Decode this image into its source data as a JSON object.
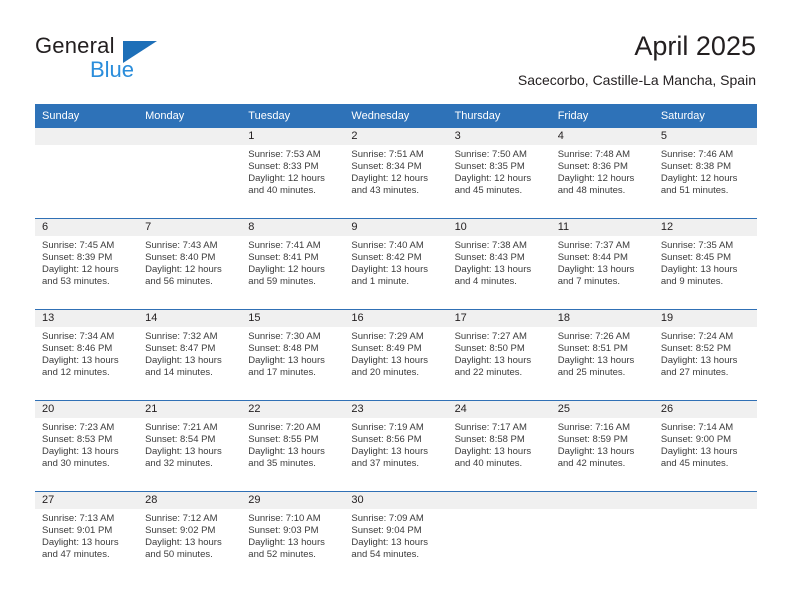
{
  "brand": {
    "name_part1": "General",
    "name_part2": "Blue",
    "flag_icon": "triangle-flag-icon",
    "color_dark": "#231f20",
    "color_blue": "#2a8ddb"
  },
  "header": {
    "title": "April 2025",
    "subtitle": "Sacecorbo, Castille-La Mancha, Spain",
    "accent_color": "#2e72b8",
    "band_color": "#f0f0f0"
  },
  "weekdays": [
    "Sunday",
    "Monday",
    "Tuesday",
    "Wednesday",
    "Thursday",
    "Friday",
    "Saturday"
  ],
  "weeks": [
    [
      {
        "day": "",
        "blank": true
      },
      {
        "day": "",
        "blank": true
      },
      {
        "day": "1",
        "sunrise": "Sunrise: 7:53 AM",
        "sunset": "Sunset: 8:33 PM",
        "daylight_1": "Daylight: 12 hours",
        "daylight_2": "and 40 minutes."
      },
      {
        "day": "2",
        "sunrise": "Sunrise: 7:51 AM",
        "sunset": "Sunset: 8:34 PM",
        "daylight_1": "Daylight: 12 hours",
        "daylight_2": "and 43 minutes."
      },
      {
        "day": "3",
        "sunrise": "Sunrise: 7:50 AM",
        "sunset": "Sunset: 8:35 PM",
        "daylight_1": "Daylight: 12 hours",
        "daylight_2": "and 45 minutes."
      },
      {
        "day": "4",
        "sunrise": "Sunrise: 7:48 AM",
        "sunset": "Sunset: 8:36 PM",
        "daylight_1": "Daylight: 12 hours",
        "daylight_2": "and 48 minutes."
      },
      {
        "day": "5",
        "sunrise": "Sunrise: 7:46 AM",
        "sunset": "Sunset: 8:38 PM",
        "daylight_1": "Daylight: 12 hours",
        "daylight_2": "and 51 minutes."
      }
    ],
    [
      {
        "day": "6",
        "sunrise": "Sunrise: 7:45 AM",
        "sunset": "Sunset: 8:39 PM",
        "daylight_1": "Daylight: 12 hours",
        "daylight_2": "and 53 minutes."
      },
      {
        "day": "7",
        "sunrise": "Sunrise: 7:43 AM",
        "sunset": "Sunset: 8:40 PM",
        "daylight_1": "Daylight: 12 hours",
        "daylight_2": "and 56 minutes."
      },
      {
        "day": "8",
        "sunrise": "Sunrise: 7:41 AM",
        "sunset": "Sunset: 8:41 PM",
        "daylight_1": "Daylight: 12 hours",
        "daylight_2": "and 59 minutes."
      },
      {
        "day": "9",
        "sunrise": "Sunrise: 7:40 AM",
        "sunset": "Sunset: 8:42 PM",
        "daylight_1": "Daylight: 13 hours",
        "daylight_2": "and 1 minute."
      },
      {
        "day": "10",
        "sunrise": "Sunrise: 7:38 AM",
        "sunset": "Sunset: 8:43 PM",
        "daylight_1": "Daylight: 13 hours",
        "daylight_2": "and 4 minutes."
      },
      {
        "day": "11",
        "sunrise": "Sunrise: 7:37 AM",
        "sunset": "Sunset: 8:44 PM",
        "daylight_1": "Daylight: 13 hours",
        "daylight_2": "and 7 minutes."
      },
      {
        "day": "12",
        "sunrise": "Sunrise: 7:35 AM",
        "sunset": "Sunset: 8:45 PM",
        "daylight_1": "Daylight: 13 hours",
        "daylight_2": "and 9 minutes."
      }
    ],
    [
      {
        "day": "13",
        "sunrise": "Sunrise: 7:34 AM",
        "sunset": "Sunset: 8:46 PM",
        "daylight_1": "Daylight: 13 hours",
        "daylight_2": "and 12 minutes."
      },
      {
        "day": "14",
        "sunrise": "Sunrise: 7:32 AM",
        "sunset": "Sunset: 8:47 PM",
        "daylight_1": "Daylight: 13 hours",
        "daylight_2": "and 14 minutes."
      },
      {
        "day": "15",
        "sunrise": "Sunrise: 7:30 AM",
        "sunset": "Sunset: 8:48 PM",
        "daylight_1": "Daylight: 13 hours",
        "daylight_2": "and 17 minutes."
      },
      {
        "day": "16",
        "sunrise": "Sunrise: 7:29 AM",
        "sunset": "Sunset: 8:49 PM",
        "daylight_1": "Daylight: 13 hours",
        "daylight_2": "and 20 minutes."
      },
      {
        "day": "17",
        "sunrise": "Sunrise: 7:27 AM",
        "sunset": "Sunset: 8:50 PM",
        "daylight_1": "Daylight: 13 hours",
        "daylight_2": "and 22 minutes."
      },
      {
        "day": "18",
        "sunrise": "Sunrise: 7:26 AM",
        "sunset": "Sunset: 8:51 PM",
        "daylight_1": "Daylight: 13 hours",
        "daylight_2": "and 25 minutes."
      },
      {
        "day": "19",
        "sunrise": "Sunrise: 7:24 AM",
        "sunset": "Sunset: 8:52 PM",
        "daylight_1": "Daylight: 13 hours",
        "daylight_2": "and 27 minutes."
      }
    ],
    [
      {
        "day": "20",
        "sunrise": "Sunrise: 7:23 AM",
        "sunset": "Sunset: 8:53 PM",
        "daylight_1": "Daylight: 13 hours",
        "daylight_2": "and 30 minutes."
      },
      {
        "day": "21",
        "sunrise": "Sunrise: 7:21 AM",
        "sunset": "Sunset: 8:54 PM",
        "daylight_1": "Daylight: 13 hours",
        "daylight_2": "and 32 minutes."
      },
      {
        "day": "22",
        "sunrise": "Sunrise: 7:20 AM",
        "sunset": "Sunset: 8:55 PM",
        "daylight_1": "Daylight: 13 hours",
        "daylight_2": "and 35 minutes."
      },
      {
        "day": "23",
        "sunrise": "Sunrise: 7:19 AM",
        "sunset": "Sunset: 8:56 PM",
        "daylight_1": "Daylight: 13 hours",
        "daylight_2": "and 37 minutes."
      },
      {
        "day": "24",
        "sunrise": "Sunrise: 7:17 AM",
        "sunset": "Sunset: 8:58 PM",
        "daylight_1": "Daylight: 13 hours",
        "daylight_2": "and 40 minutes."
      },
      {
        "day": "25",
        "sunrise": "Sunrise: 7:16 AM",
        "sunset": "Sunset: 8:59 PM",
        "daylight_1": "Daylight: 13 hours",
        "daylight_2": "and 42 minutes."
      },
      {
        "day": "26",
        "sunrise": "Sunrise: 7:14 AM",
        "sunset": "Sunset: 9:00 PM",
        "daylight_1": "Daylight: 13 hours",
        "daylight_2": "and 45 minutes."
      }
    ],
    [
      {
        "day": "27",
        "sunrise": "Sunrise: 7:13 AM",
        "sunset": "Sunset: 9:01 PM",
        "daylight_1": "Daylight: 13 hours",
        "daylight_2": "and 47 minutes."
      },
      {
        "day": "28",
        "sunrise": "Sunrise: 7:12 AM",
        "sunset": "Sunset: 9:02 PM",
        "daylight_1": "Daylight: 13 hours",
        "daylight_2": "and 50 minutes."
      },
      {
        "day": "29",
        "sunrise": "Sunrise: 7:10 AM",
        "sunset": "Sunset: 9:03 PM",
        "daylight_1": "Daylight: 13 hours",
        "daylight_2": "and 52 minutes."
      },
      {
        "day": "30",
        "sunrise": "Sunrise: 7:09 AM",
        "sunset": "Sunset: 9:04 PM",
        "daylight_1": "Daylight: 13 hours",
        "daylight_2": "and 54 minutes."
      },
      {
        "day": "",
        "blank": true
      },
      {
        "day": "",
        "blank": true
      },
      {
        "day": "",
        "blank": true
      }
    ]
  ]
}
